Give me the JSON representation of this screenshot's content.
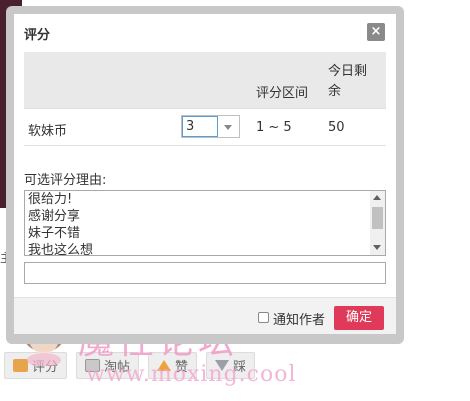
{
  "background": {
    "fragment_text": "主",
    "bottom_buttons": [
      {
        "label": "评分",
        "icon": "rate-icon"
      },
      {
        "label": "淘帖",
        "icon": "collect-icon"
      },
      {
        "label": "赞",
        "icon": "thumb-up-icon"
      },
      {
        "label": "踩",
        "icon": "thumb-down-icon"
      }
    ]
  },
  "watermark": {
    "title": "魔性论坛",
    "url": "www.moxing.cool"
  },
  "dialog": {
    "title": "评分",
    "close_icon": "×",
    "columns": {
      "range": "评分区间",
      "remaining": "今日剩余"
    },
    "row": {
      "currency": "软妹币",
      "score_value": "3",
      "range": "1 ~ 5",
      "remaining": "50"
    },
    "reason_label": "可选评分理由:",
    "reasons": [
      "很给力!",
      "感谢分享",
      "妹子不错",
      "我也这么想"
    ],
    "reason_input_value": "",
    "notify_label": "通知作者",
    "notify_checked": false,
    "confirm_label": "确定"
  },
  "colors": {
    "confirm": "#e03a5a",
    "frame": "#c8c8c8",
    "watermark": "#f0a0c8"
  }
}
